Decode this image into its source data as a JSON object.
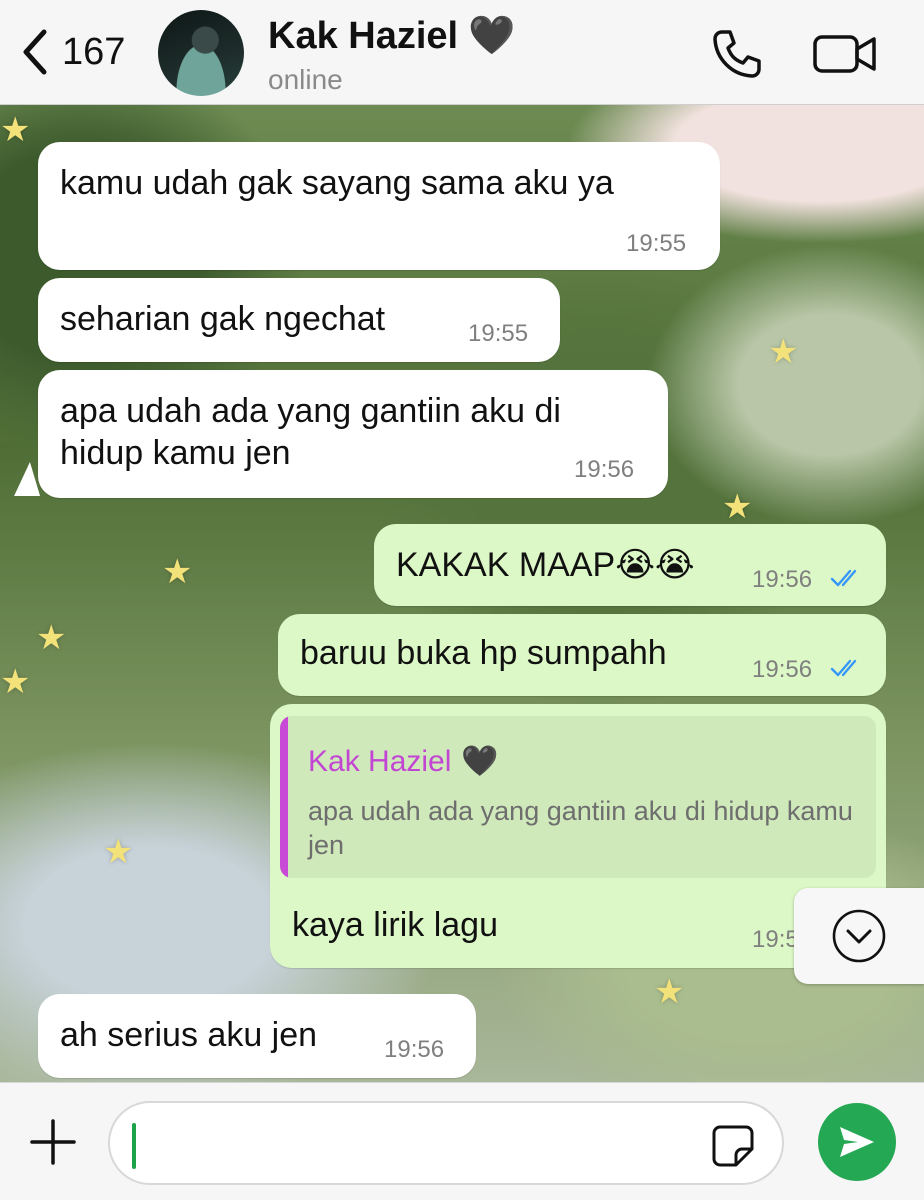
{
  "header": {
    "back_count": "167",
    "contact_name": "Kak Haziel",
    "contact_emoji": "🖤",
    "status": "online"
  },
  "messages": [
    {
      "direction": "incoming",
      "text": "kamu udah gak sayang sama aku ya",
      "time": "19:55"
    },
    {
      "direction": "incoming",
      "text": "seharian gak ngechat",
      "time": "19:55"
    },
    {
      "direction": "incoming",
      "text_line1": "apa udah ada yang gantiin aku di",
      "text_line2": "hidup kamu jen",
      "time": "19:56"
    },
    {
      "direction": "outgoing",
      "text": "KAKAK MAAP😭😭",
      "time": "19:56",
      "status": "read"
    },
    {
      "direction": "outgoing",
      "text": "baruu buka hp sumpahh",
      "time": "19:56",
      "status": "read"
    },
    {
      "direction": "outgoing",
      "reply_to": {
        "name": "Kak Haziel",
        "emoji": "🖤",
        "text": "apa udah ada yang gantiin aku di hidup kamu jen"
      },
      "text": "kaya lirik lagu",
      "time_partial": "19:5"
    },
    {
      "direction": "incoming",
      "text": "ah serius aku jen",
      "time": "19:56"
    }
  ],
  "colors": {
    "incoming_bubble": "#ffffff",
    "outgoing_bubble": "#dcf8c6",
    "reply_accent": "#c849d6",
    "read_ticks": "#3497f9",
    "send_button": "#25a853"
  },
  "input": {
    "value": ""
  },
  "icons": [
    "chevron-left-icon",
    "phone-icon",
    "video-icon",
    "chevron-down-icon",
    "plus-icon",
    "sticker-icon",
    "send-icon"
  ]
}
